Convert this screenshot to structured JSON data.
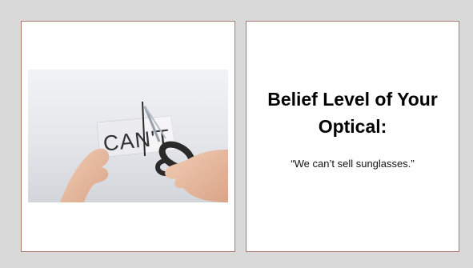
{
  "slide": {
    "background_color": "#d9d9d9",
    "border_color": "#b07a72",
    "image": {
      "label_text": "CAN'T",
      "description_icon": "scissors-cutting-cant-sign"
    },
    "title": "Belief Level of Your Optical:",
    "quote": "“We can’t  sell sunglasses.”"
  }
}
